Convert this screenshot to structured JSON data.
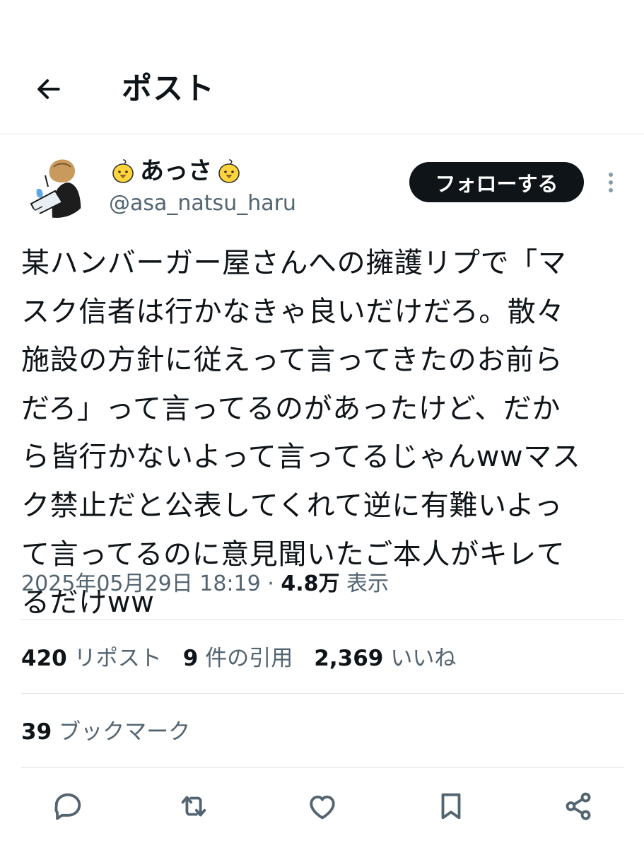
{
  "header": {
    "title": "ポスト",
    "back_icon": "arrow-left-icon"
  },
  "author": {
    "display_name": "あっさ",
    "name_decoration_icon": "chick-icon",
    "handle": "@asa_natsu_haru",
    "follow_label": "フォローする",
    "more_icon": "more-vertical-icon"
  },
  "post": {
    "lines": [
      "某ハンバーガー屋さんへの擁護リプで「マ",
      "スク信者は行かなきゃ良いだけだろ。散々",
      "施設の方針に従えって言ってきたのお前ら",
      "だろ」って言ってるのがあったけど、だか",
      "ら皆行かないよって言ってるじゃんwwマス",
      "ク禁止だと公表してくれて逆に有難いよっ",
      "て言ってるのに意見聞いたご本人がキレて",
      "るだけww"
    ]
  },
  "meta": {
    "timestamp": "2025年05月29日 18:19",
    "separator": "·",
    "views_count": "4.8万",
    "views_label": "表示"
  },
  "stats": {
    "reposts_count": "420",
    "reposts_label": "リポスト",
    "quotes_count": "9",
    "quotes_label": "件の引用",
    "likes_count": "2,369",
    "likes_label": "いいね"
  },
  "bookmarks": {
    "count": "39",
    "label": "ブックマーク"
  },
  "actions": {
    "reply_icon": "reply-icon",
    "repost_icon": "repost-icon",
    "like_icon": "heart-icon",
    "bookmark_icon": "bookmark-icon",
    "share_icon": "share-icon"
  },
  "colors": {
    "text_primary": "#0f1419",
    "text_secondary": "#536471",
    "divider": "#e3e6e9",
    "follow_bg": "#0f1419",
    "chick_yellow": "#ffd43b"
  }
}
